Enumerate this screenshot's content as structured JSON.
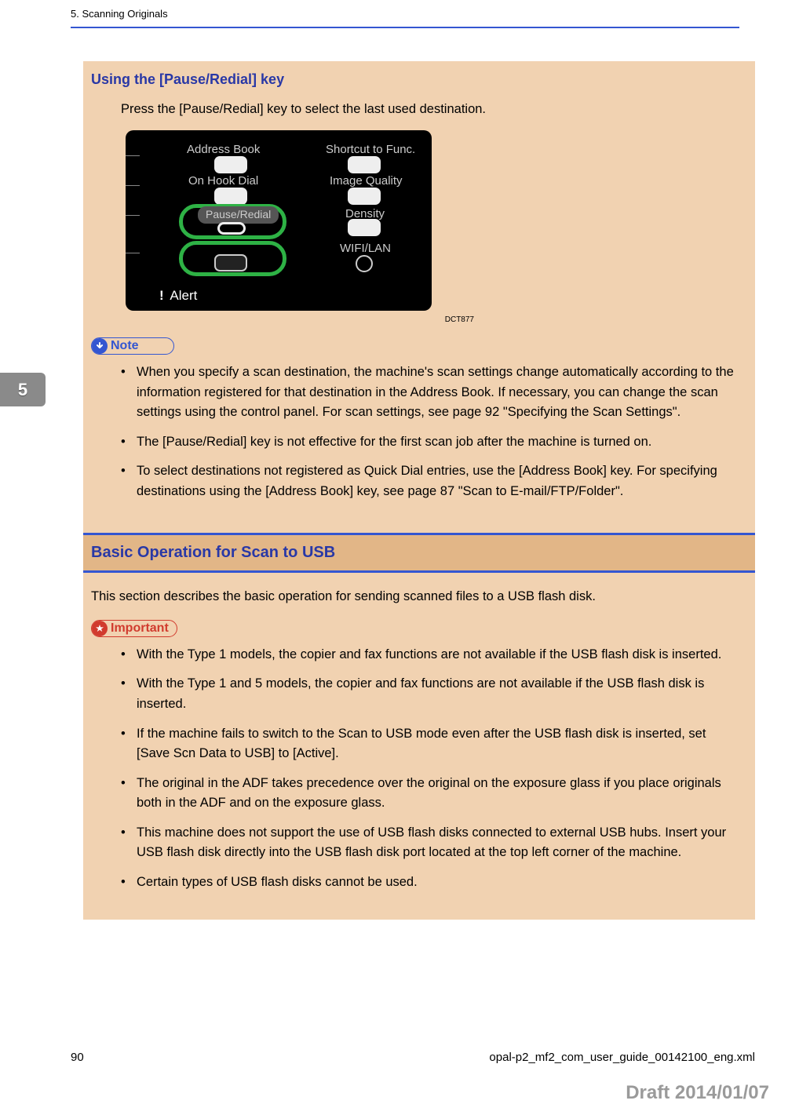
{
  "header": {
    "chapter": "5. Scanning Originals"
  },
  "tab_number": "5",
  "section1": {
    "subheading": "Using the [Pause/Redial] key",
    "intro": "Press the [Pause/Redial] key to select the last used destination.",
    "panel": {
      "address_book": "Address Book",
      "on_hook_dial": "On Hook Dial",
      "pause_redial": "Pause/Redial",
      "shortcut_to_func": "Shortcut to Func.",
      "image_quality": "Image Quality",
      "density": "Density",
      "wifi_lan": "WIFI/LAN",
      "alert": "Alert",
      "code": "DCT877"
    },
    "note_label": "Note",
    "notes": [
      "When you specify a scan destination, the machine's scan settings change automatically according to the information registered for that destination in the Address Book. If necessary, you can change the scan settings using the control panel. For scan settings, see page 92 \"Specifying the Scan Settings\".",
      "The [Pause/Redial] key is not effective for the first scan job after the machine is turned on.",
      "To select destinations not registered as Quick Dial entries, use the [Address Book] key. For specifying destinations using the [Address Book] key, see page 87 \"Scan to E-mail/FTP/Folder\"."
    ]
  },
  "section2": {
    "heading": "Basic Operation for Scan to USB",
    "intro": "This section describes the basic operation for sending scanned files to a USB flash disk.",
    "important_label": "Important",
    "important": [
      "With the Type 1 models, the copier and fax functions are not available if the USB flash disk is inserted.",
      "With the Type 1 and 5 models, the copier and fax functions are not available if the USB flash disk is inserted.",
      "If the machine fails to switch to the Scan to USB mode even after the USB flash disk is inserted, set [Save Scn Data to USB] to [Active].",
      "The original in the ADF takes precedence over the original on the exposure glass if you place originals both in the ADF and on the exposure glass.",
      "This machine does not support the use of USB flash disks connected to external USB hubs. Insert your USB flash disk directly into the USB flash disk port located at the top left corner of the machine.",
      "Certain types of USB flash disks cannot be used."
    ]
  },
  "footer": {
    "page": "90",
    "file": "opal-p2_mf2_com_user_guide_00142100_eng.xml"
  },
  "draft": "Draft 2014/01/07"
}
